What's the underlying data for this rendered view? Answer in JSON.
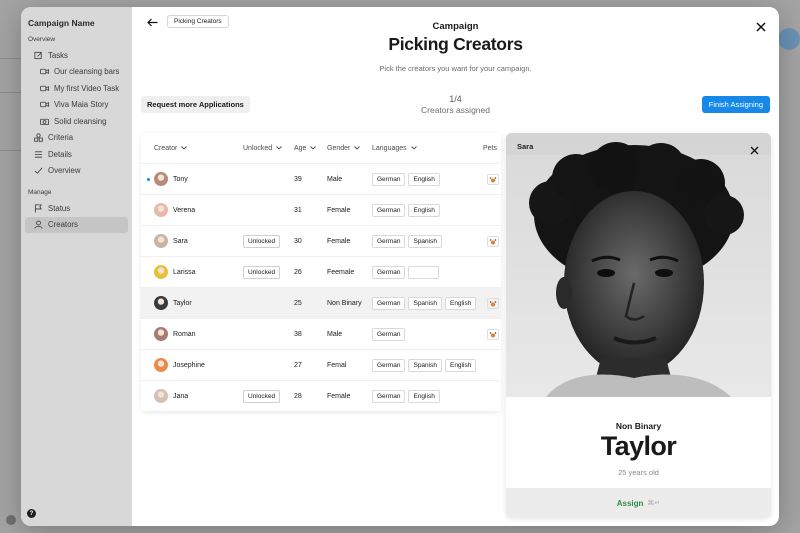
{
  "colors": {
    "accent": "#1688e8",
    "assign_green": "#2f8f48"
  },
  "sidebar": {
    "title": "Campaign Name",
    "overview_section": "Overview",
    "manage_section": "Manage",
    "items": [
      {
        "label": "Tasks",
        "icon": "edit-icon"
      },
      {
        "label": "Our cleansing bars",
        "icon": "video-icon"
      },
      {
        "label": "My first Video Task",
        "icon": "video-icon"
      },
      {
        "label": "Viva Maia Story",
        "icon": "video-icon"
      },
      {
        "label": "Solid cleansing",
        "icon": "camera-icon"
      },
      {
        "label": "Criteria",
        "icon": "shapes-icon"
      },
      {
        "label": "Details",
        "icon": "list-icon"
      },
      {
        "label": "Overview",
        "icon": "check-icon"
      },
      {
        "label": "Status",
        "icon": "flag-icon"
      },
      {
        "label": "Creators",
        "icon": "user-icon"
      }
    ],
    "help": "?"
  },
  "header": {
    "breadcrumb": "Picking Creators",
    "eyebrow": "Campaign",
    "title": "Picking Creators",
    "subtitle": "Pick the creators you want for your campaign."
  },
  "toolbar": {
    "request_label": "Request more Applications",
    "progress_count": "1/4",
    "progress_label": "Creators assigned",
    "finish_label": "Finish Assigning"
  },
  "table": {
    "headers": {
      "creator": "Creator",
      "unlocked": "Unlocked",
      "age": "Age",
      "gender": "Gender",
      "languages": "Languages",
      "pets": "Pets"
    },
    "rows": [
      {
        "name": "Tony",
        "unlocked": "",
        "age": "39",
        "gender": "Male",
        "languages": [
          "German",
          "English"
        ],
        "pet": true,
        "new": true,
        "avatar": "#b98a7a"
      },
      {
        "name": "Verena",
        "unlocked": "",
        "age": "31",
        "gender": "Female",
        "languages": [
          "German",
          "English"
        ],
        "pet": false,
        "new": false,
        "avatar": "#e8b9a8"
      },
      {
        "name": "Sara",
        "unlocked": "Unlocked",
        "age": "30",
        "gender": "Female",
        "languages": [
          "German",
          "Spanish"
        ],
        "pet": true,
        "new": false,
        "avatar": "#c9b5a4"
      },
      {
        "name": "Larissa",
        "unlocked": "Unlocked",
        "age": "26",
        "gender": "Feemale",
        "languages": [
          "German",
          ""
        ],
        "pet": false,
        "new": false,
        "avatar": "#e8c13a"
      },
      {
        "name": "Taylor",
        "unlocked": "",
        "age": "25",
        "gender": "Non Binary",
        "languages": [
          "German",
          "Spanish",
          "English"
        ],
        "pet": true,
        "new": false,
        "avatar": "#3a3a3a",
        "highlighted": true
      },
      {
        "name": "Roman",
        "unlocked": "",
        "age": "38",
        "gender": "Male",
        "languages": [
          "German"
        ],
        "pet": true,
        "new": false,
        "avatar": "#a87c74"
      },
      {
        "name": "Josephine",
        "unlocked": "",
        "age": "27",
        "gender": "Femal",
        "languages": [
          "German",
          "Spanish",
          "English"
        ],
        "pet": false,
        "new": false,
        "avatar": "#e98b4a"
      },
      {
        "name": "Jana",
        "unlocked": "Unlocked",
        "age": "28",
        "gender": "Female",
        "languages": [
          "German",
          "English"
        ],
        "pet": false,
        "new": false,
        "avatar": "#d5c2b4"
      }
    ]
  },
  "detail": {
    "tab_name": "Sara",
    "gender": "Non Binary",
    "name": "Taylor",
    "age": "25 years old",
    "assign_label": "Assign",
    "assign_shortcut": "⌘↵"
  }
}
